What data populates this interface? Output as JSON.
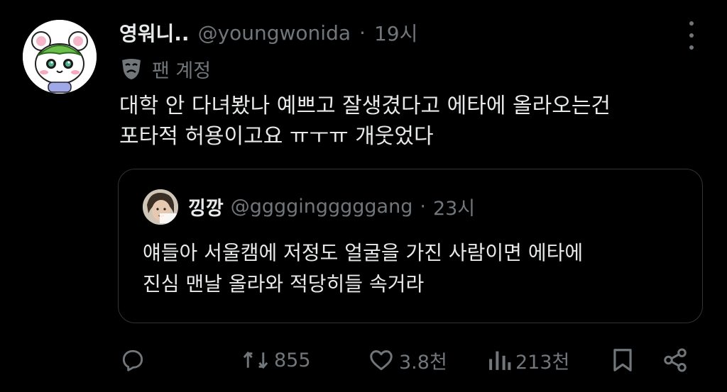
{
  "tweet": {
    "author_name": "영워니..",
    "handle": "@youngwonida",
    "separator": "·",
    "time": "19시",
    "account_label": "팬 계정",
    "text_line1": "대학 안 다녀봤나 예쁘고 잘생겼다고 에타에 올라오는건",
    "text_line2": "포타적 허용이고요 ㅠㅜㅠ 개웃었다"
  },
  "quoted_tweet": {
    "author_name": "낑깡",
    "handle": "@ggggingggggang",
    "separator": "·",
    "time": "23시",
    "text_line1": "얘들아 서울캠에 저정도 얼굴을 가진 사람이면 에타에",
    "text_line2": "진심 맨날 올라와 적당히들 속거라"
  },
  "actions": {
    "reply_count": "",
    "retweet_count": "855",
    "like_count": "3.8천",
    "view_count": "213천"
  },
  "colors": {
    "background": "#000000",
    "text_primary": "#e7e9ea",
    "text_secondary": "#71767b",
    "border": "#2f3336"
  },
  "icons": {
    "more": "more-vertical-icon",
    "fan_account": "theater-mask-icon",
    "reply": "reply-icon",
    "retweet": "retweet-icon",
    "like": "heart-icon",
    "views": "bar-chart-icon",
    "bookmark": "bookmark-icon",
    "share": "share-icon"
  }
}
